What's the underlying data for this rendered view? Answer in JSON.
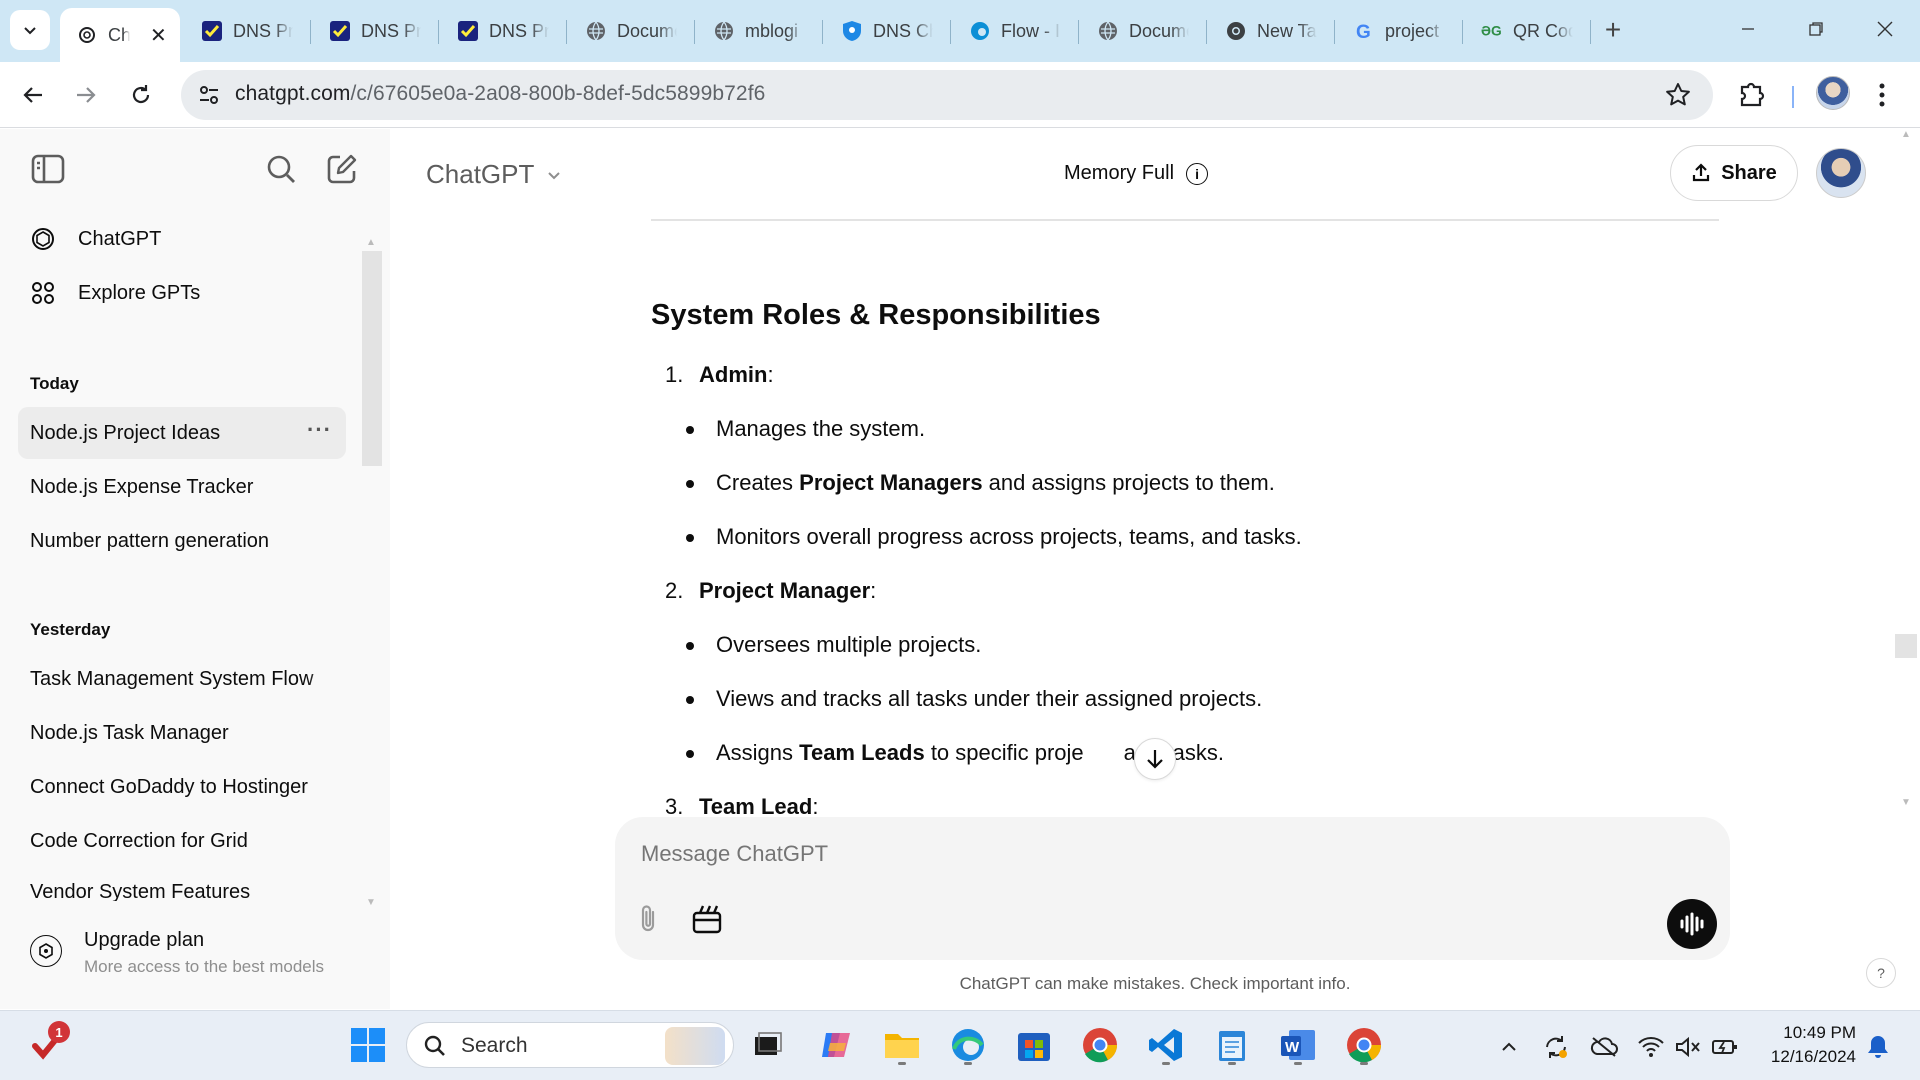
{
  "browser": {
    "tabs": [
      {
        "label": "ChatGPT",
        "icon": "chatgpt-icon",
        "active": true
      },
      {
        "label": "DNS Propagation",
        "icon": "checklist-icon"
      },
      {
        "label": "DNS Propagation",
        "icon": "checklist-icon"
      },
      {
        "label": "DNS Propagation",
        "icon": "checklist-icon"
      },
      {
        "label": "Document",
        "icon": "globe-icon"
      },
      {
        "label": "mblogi",
        "icon": "globe-icon"
      },
      {
        "label": "DNS Checker",
        "icon": "shield-icon"
      },
      {
        "label": "Flow - I",
        "icon": "edge-icon"
      },
      {
        "label": "Document",
        "icon": "globe-icon"
      },
      {
        "label": "New Tab",
        "icon": "chrome-icon"
      },
      {
        "label": "project",
        "icon": "google-icon"
      },
      {
        "label": "QR Code",
        "icon": "gfg-icon"
      }
    ],
    "url_host": "chatgpt.com",
    "url_path": "/c/67605e0a-2a08-800b-8def-5dc5899b72f6"
  },
  "sidebar": {
    "nav": [
      {
        "label": "ChatGPT",
        "icon": "openai-logo-icon"
      },
      {
        "label": "Explore GPTs",
        "icon": "grid-icon"
      }
    ],
    "sections": [
      {
        "title": "Today",
        "items": [
          "Node.js Project Ideas",
          "Node.js Expense Tracker",
          "Number pattern generation"
        ]
      },
      {
        "title": "Yesterday",
        "items": [
          "Task Management System Flow",
          "Node.js Task Manager",
          "Connect GoDaddy to Hostinger",
          "Code Correction for Grid",
          "Vendor System Features"
        ]
      }
    ],
    "upgrade": {
      "title": "Upgrade plan",
      "subtitle": "More access to the best models"
    }
  },
  "header": {
    "model": "ChatGPT",
    "memory": "Memory Full",
    "share": "Share"
  },
  "content": {
    "heading": "System Roles & Responsibilities",
    "roles": [
      {
        "num": "1.",
        "name": "Admin",
        "suffix": ":",
        "bullets": [
          {
            "pre": "Manages the system.",
            "bold": "",
            "post": ""
          },
          {
            "pre": "Creates ",
            "bold": "Project Managers",
            "post": " and assigns projects to them."
          },
          {
            "pre": "Monitors overall progress across projects, teams, and tasks.",
            "bold": "",
            "post": ""
          }
        ]
      },
      {
        "num": "2.",
        "name": "Project Manager",
        "suffix": ":",
        "bullets": [
          {
            "pre": "Oversees multiple projects.",
            "bold": "",
            "post": ""
          },
          {
            "pre": "Views and tracks all tasks under their assigned projects.",
            "bold": "",
            "post": ""
          },
          {
            "pre": "Assigns ",
            "bold": "Team Leads",
            "post": " to specific proje",
            "post2": "and tasks."
          }
        ]
      },
      {
        "num": "3.",
        "name": "Team Lead",
        "suffix": ":"
      }
    ]
  },
  "composer": {
    "placeholder": "Message ChatGPT",
    "disclaimer": "ChatGPT can make mistakes. Check important info.",
    "help": "?"
  },
  "taskbar": {
    "search": "Search",
    "notification_count": "1",
    "time": "10:49 PM",
    "date": "12/16/2024"
  }
}
